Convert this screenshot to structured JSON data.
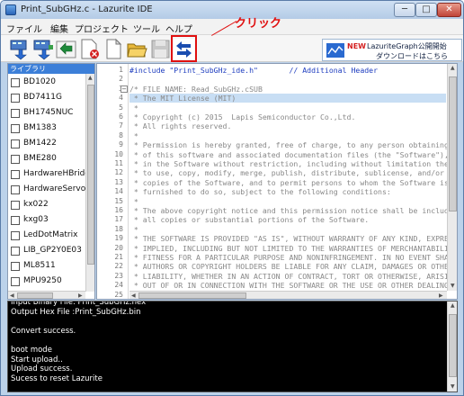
{
  "window": {
    "title": "Print_SubGHz.c - Lazurite IDE",
    "min": "─",
    "max": "□",
    "close": "✕"
  },
  "menu": [
    "ファイル",
    "編集",
    "プロジェクト",
    "ツール",
    "ヘルプ"
  ],
  "annotation": {
    "label": "クリック",
    "color": "#e01010"
  },
  "toolbar": {
    "buttons": [
      "build-icon",
      "upload-icon",
      "rebuild-icon",
      "clean-icon",
      "new-file-icon",
      "open-folder-icon",
      "save-icon",
      "switch-icon"
    ]
  },
  "banner": {
    "new": "NEW",
    "line1": "LazuriteGraph公開開始",
    "line2": "ダウンロードはこちら"
  },
  "library": {
    "header": "ライブラリ",
    "items": [
      "BD1020",
      "BD7411G",
      "BH1745NUC",
      "BM1383",
      "BM1422",
      "BME280",
      "HardwareHBridge",
      "HardwareServo",
      "kx022",
      "kxg03",
      "LedDotMatrix",
      "LIB_GP2Y0E03",
      "ML8511",
      "MPU9250"
    ]
  },
  "editor": {
    "line_numbers": [
      "1",
      "2",
      "3",
      "4",
      "5",
      "6",
      "7",
      "8",
      "9",
      "10",
      "11",
      "12",
      "13",
      "14",
      "15",
      "16",
      "17",
      "18",
      "19",
      "20",
      "21",
      "22",
      "23",
      "24",
      "25"
    ],
    "lines": [
      {
        "t": "#include \"Print_SubGHz_ide.h\"       // Additional Header",
        "style": "include"
      },
      {
        "t": "",
        "style": "blank"
      },
      {
        "t": "/* FILE NAME: Read_SubGHz.cSUB",
        "style": "comment"
      },
      {
        "t": " * The MIT License (MIT)",
        "style": "comment-hl"
      },
      {
        "t": " *",
        "style": "comment"
      },
      {
        "t": " * Copyright (c) 2015  Lapis Semiconductor Co.,Ltd.",
        "style": "comment"
      },
      {
        "t": " * All rights reserved.",
        "style": "comment"
      },
      {
        "t": " *",
        "style": "comment"
      },
      {
        "t": " * Permission is hereby granted, free of charge, to any person obtaining a",
        "style": "comment"
      },
      {
        "t": " * of this software and associated documentation files (the \"Software\"), t",
        "style": "comment"
      },
      {
        "t": " * in the Software without restriction, including without limitation the r",
        "style": "comment"
      },
      {
        "t": " * to use, copy, modify, merge, publish, distribute, sublicense, and/or se",
        "style": "comment"
      },
      {
        "t": " * copies of the Software, and to permit persons to whom the Software is",
        "style": "comment"
      },
      {
        "t": " * furnished to do so, subject to the following conditions:",
        "style": "comment"
      },
      {
        "t": " *",
        "style": "comment"
      },
      {
        "t": " * The above copyright notice and this permission notice shall be included",
        "style": "comment"
      },
      {
        "t": " * all copies or substantial portions of the Software.",
        "style": "comment"
      },
      {
        "t": " *",
        "style": "comment"
      },
      {
        "t": " * THE SOFTWARE IS PROVIDED \"AS IS\", WITHOUT WARRANTY OF ANY KIND, EXPRESS",
        "style": "comment"
      },
      {
        "t": " * IMPLIED, INCLUDING BUT NOT LIMITED TO THE WARRANTIES OF MERCHANTABILITY",
        "style": "comment"
      },
      {
        "t": " * FITNESS FOR A PARTICULAR PURPOSE AND NONINFRINGEMENT. IN NO EVENT SHALL",
        "style": "comment"
      },
      {
        "t": " * AUTHORS OR COPYRIGHT HOLDERS BE LIABLE FOR ANY CLAIM, DAMAGES OR OTHER",
        "style": "comment"
      },
      {
        "t": " * LIABILITY, WHETHER IN AN ACTION OF CONTRACT, TORT OR OTHERWISE, ARISING",
        "style": "comment"
      },
      {
        "t": " * OUT OF OR IN CONNECTION WITH THE SOFTWARE OR THE USE OR OTHER DEALINGS",
        "style": "comment"
      },
      {
        "t": "",
        "style": "blank"
      }
    ]
  },
  "output": {
    "lines": [
      "Input Binary File: Print_SubGHz.hex",
      "Output Hex File :Print_SubGHz.bin",
      "",
      "Convert success.",
      "",
      "boot mode",
      "Start upload..",
      "Upload success.",
      "Sucess to reset Lazurite"
    ]
  }
}
